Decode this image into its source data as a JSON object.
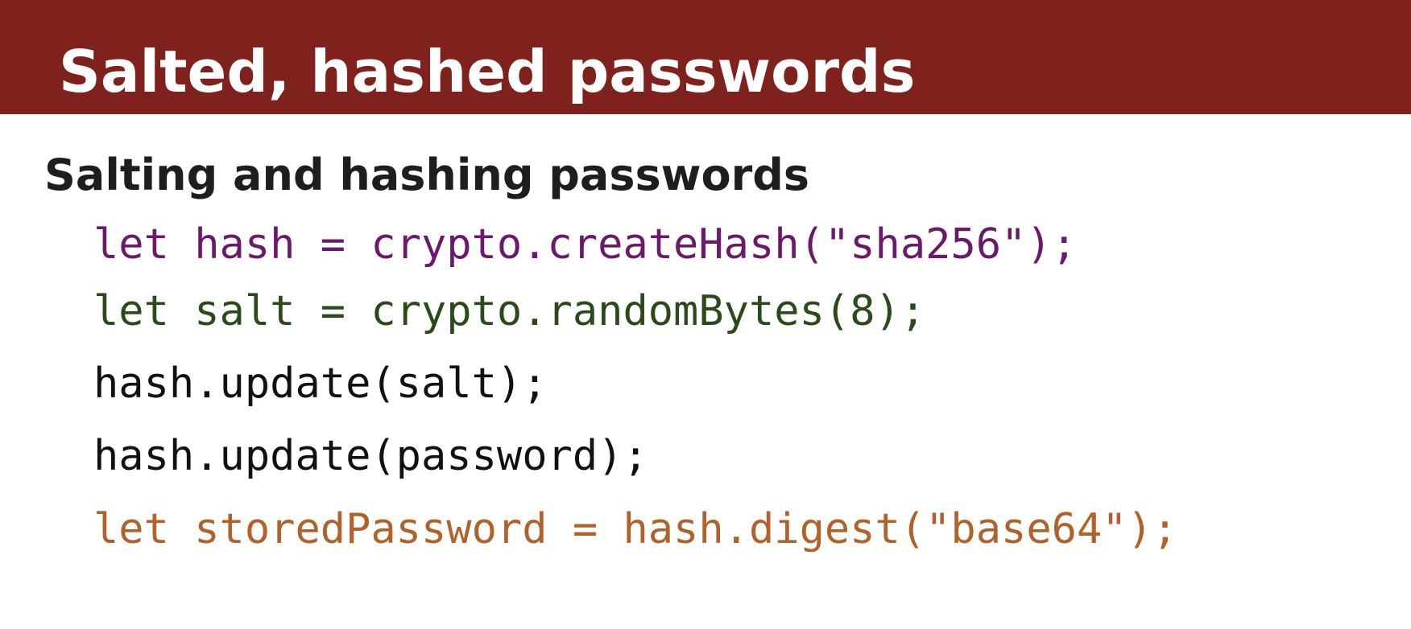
{
  "slide": {
    "title": "Salted, hashed passwords",
    "subheading": "Salting and hashing passwords"
  },
  "code": {
    "lines": [
      {
        "text": "let hash = crypto.createHash(\"sha256\");",
        "color": "#6b1a6b"
      },
      {
        "text": "let salt = crypto.randomBytes(8);",
        "color": "#2b4a1c"
      },
      {
        "text": "hash.update(salt);",
        "color": "#111111"
      },
      {
        "text": "hash.update(password);",
        "color": "#111111"
      },
      {
        "text": "let storedPassword = hash.digest(\"base64\");",
        "color": "#b0622a"
      }
    ]
  },
  "colors": {
    "title_bar": "#7f221e",
    "title_text": "#ffffff",
    "heading_text": "#1e1e1e"
  }
}
